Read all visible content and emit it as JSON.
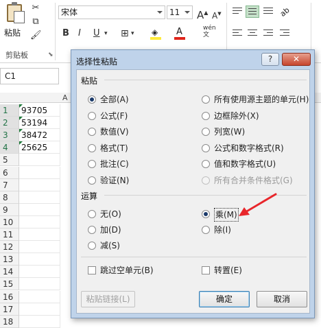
{
  "ribbon": {
    "paste_label": "粘贴",
    "clipboard_group": "剪贴板",
    "font_name": "宋体",
    "font_size": "11",
    "grow_font": "A",
    "shrink_font": "A",
    "bold": "B",
    "italic": "I",
    "underline": "U",
    "phonetic": "wén"
  },
  "formula_bar": {
    "name_box": "C1"
  },
  "sheet": {
    "column_header": "A",
    "rows": [
      "1",
      "2",
      "3",
      "4",
      "5",
      "6",
      "7",
      "8",
      "9",
      "10",
      "11",
      "12",
      "13",
      "14",
      "15",
      "16",
      "17",
      "18"
    ],
    "cells": [
      "93705",
      "53194",
      "38472",
      "25625"
    ]
  },
  "dialog": {
    "title": "选择性粘贴",
    "help_btn": "?",
    "close_btn": "✕",
    "paste_section": "粘贴",
    "paste_options_left": [
      "全部(A)",
      "公式(F)",
      "数值(V)",
      "格式(T)",
      "批注(C)",
      "验证(N)"
    ],
    "paste_options_right": [
      "所有使用源主题的单元(H)",
      "边框除外(X)",
      "列宽(W)",
      "公式和数字格式(R)",
      "值和数字格式(U)",
      "所有合并条件格式(G)"
    ],
    "operation_section": "运算",
    "operation_left": [
      "无(O)",
      "加(D)",
      "减(S)"
    ],
    "operation_right": [
      "乘(M)",
      "除(I)"
    ],
    "skip_blanks": "跳过空单元(B)",
    "transpose": "转置(E)",
    "paste_link": "粘贴链接(L)",
    "ok": "确定",
    "cancel": "取消"
  },
  "colors": {
    "arrow": "#e8262b",
    "title_bar": "#bfd3ea",
    "selected_radio": "#1b3a6a"
  }
}
